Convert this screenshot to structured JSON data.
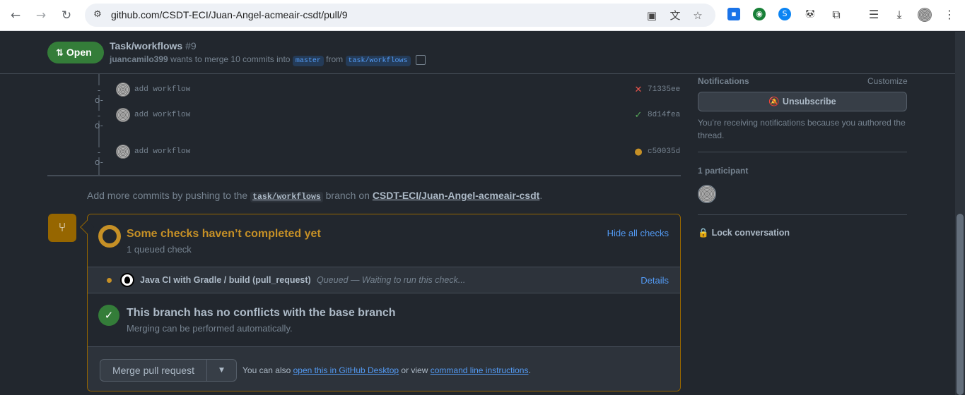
{
  "browser": {
    "url": "github.com/CSDT-ECI/Juan-Angel-acmeair-csdt/pull/9",
    "icons": [
      "back-icon",
      "forward-icon",
      "reload-icon",
      "site-settings-icon",
      "install-icon",
      "translate-icon",
      "bookmark-star-icon",
      "extensions-icon",
      "media-icon",
      "downloads-icon",
      "profile-avatar",
      "menu-icon"
    ]
  },
  "pr": {
    "state": "Open",
    "title": "Task/workflows",
    "number": "#9",
    "author": "juancamilo399",
    "merge_text": "wants to merge 10 commits into",
    "base_branch": "master",
    "from_text": "from",
    "head_branch": "task/workflows"
  },
  "commits": [
    {
      "message": "add workflow",
      "sha": "71335ee",
      "status": "failure"
    },
    {
      "message": "add workflow",
      "sha": "8d14fea",
      "status": "success"
    },
    {
      "message": "add workflow",
      "sha": "c50035d",
      "status": "pending"
    }
  ],
  "push_note": {
    "prefix": "Add more commits by pushing to the",
    "branch": "task/workflows",
    "middle": "branch on",
    "repo": "CSDT-ECI/Juan-Angel-acmeair-csdt",
    "suffix": "."
  },
  "checks": {
    "title": "Some checks haven’t completed yet",
    "subtitle": "1 queued check",
    "hide_label": "Hide all checks",
    "items": [
      {
        "name": "Java CI with Gradle / build (pull_request)",
        "state": "Queued — Waiting to run this check...",
        "details": "Details"
      }
    ]
  },
  "conflicts": {
    "title": "This branch has no conflicts with the base branch",
    "subtitle": "Merging can be performed automatically."
  },
  "merge": {
    "button": "Merge pull request",
    "hint_prefix": "You can also",
    "desktop_link": "open this in GitHub Desktop",
    "hint_middle": "or view",
    "cli_link": "command line instructions",
    "hint_suffix": "."
  },
  "sidebar": {
    "notifications_label": "Notifications",
    "customize": "Customize",
    "unsubscribe": "Unsubscribe",
    "notification_note": "You’re receiving notifications because you authored the thread.",
    "participants_label": "1 participant",
    "lock": "Lock conversation"
  },
  "colors": {
    "success": "#57ab5a",
    "failure": "#e5534b",
    "pending": "#c69026",
    "link": "#539bf5",
    "open_badge": "#347d39"
  }
}
